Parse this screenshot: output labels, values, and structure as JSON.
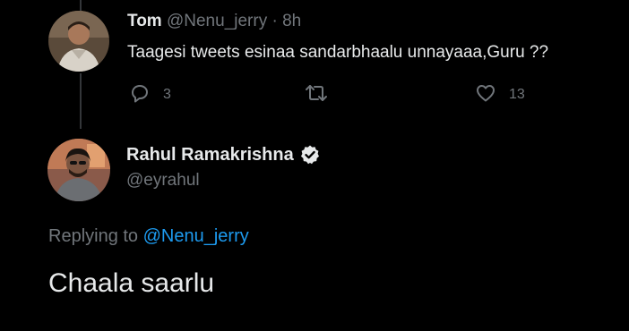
{
  "reply_tweet": {
    "author_name": "Tom",
    "author_handle": "@Nenu_jerry",
    "separator": "·",
    "time": "8h",
    "text": "Taagesi tweets esinaa sandarbhaalu unnayaaa,Guru ??",
    "actions": {
      "reply_count": "3",
      "retweet_count": "",
      "like_count": "13"
    }
  },
  "main_tweet": {
    "author_name": "Rahul Ramakrishna",
    "author_handle": "@eyrahul",
    "verified": true,
    "replying_prefix": "Replying to",
    "replying_to": "@Nenu_jerry",
    "text": "Chaala saarlu"
  },
  "colors": {
    "background": "#000000",
    "primary_text": "#e7e9ea",
    "secondary_text": "#71767b",
    "link": "#1d9bf0",
    "thread_line": "#333639"
  },
  "icons": {
    "reply": "reply-icon",
    "retweet": "retweet-icon",
    "like": "heart-icon",
    "verified": "verified-badge-icon"
  }
}
